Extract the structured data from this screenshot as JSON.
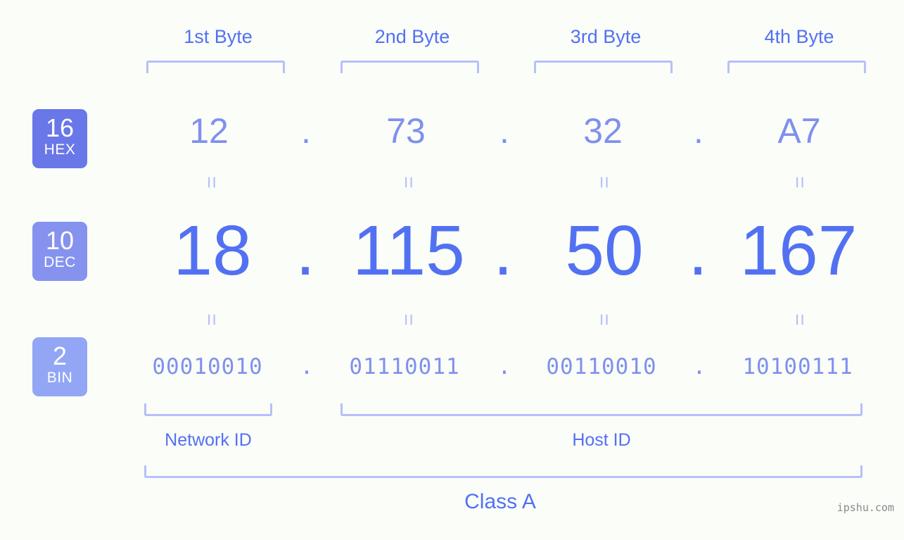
{
  "colors": {
    "background": "#fbfdf9",
    "accent_strong": "#5271f2",
    "accent_mid": "#8090ee",
    "accent_light": "#b6c0fb",
    "badge_hex": "#6a77e8",
    "badge_dec": "#8593ef",
    "badge_bin": "#92a6f5",
    "watermark": "#8a8a8a"
  },
  "byte_headers": [
    {
      "label": "1st Byte"
    },
    {
      "label": "2nd Byte"
    },
    {
      "label": "3rd Byte"
    },
    {
      "label": "4th Byte"
    }
  ],
  "badges": [
    {
      "number": "16",
      "system": "HEX"
    },
    {
      "number": "10",
      "system": "DEC"
    },
    {
      "number": "2",
      "system": "BIN"
    }
  ],
  "rows": {
    "hex": {
      "values": [
        "12",
        "73",
        "32",
        "A7"
      ],
      "separator": "."
    },
    "dec": {
      "values": [
        "18",
        "115",
        "50",
        "167"
      ],
      "separator": "."
    },
    "bin": {
      "values": [
        "00010010",
        "01110011",
        "00110010",
        "10100111"
      ],
      "separator": "."
    }
  },
  "equals_symbol": "=",
  "segments": {
    "network_id": "Network ID",
    "host_id": "Host ID"
  },
  "class_label": "Class A",
  "watermark": "ipshu.com",
  "chart_data": {
    "type": "table",
    "title": "Class A",
    "ip_address": "18.115.50.167",
    "columns": [
      "1st Byte",
      "2nd Byte",
      "3rd Byte",
      "4th Byte"
    ],
    "series": [
      {
        "name": "HEX",
        "base": 16,
        "values": [
          "12",
          "73",
          "32",
          "A7"
        ]
      },
      {
        "name": "DEC",
        "base": 10,
        "values": [
          "18",
          "115",
          "50",
          "167"
        ]
      },
      {
        "name": "BIN",
        "base": 2,
        "values": [
          "00010010",
          "01110011",
          "00110010",
          "10100111"
        ]
      }
    ],
    "network_id_bytes": [
      1
    ],
    "host_id_bytes": [
      2,
      3,
      4
    ]
  }
}
